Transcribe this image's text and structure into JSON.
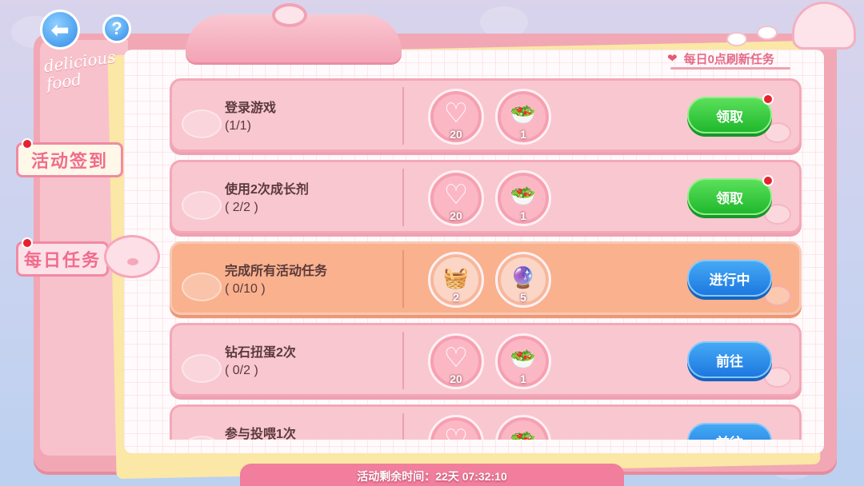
{
  "nav": {
    "back_icon": "back-arrow-icon",
    "help_label": "?"
  },
  "logo": {
    "line1": "delicious",
    "line2": "food"
  },
  "sidebar": {
    "tabs": [
      {
        "label": "活动签到",
        "badge": true
      },
      {
        "label": "每日任务",
        "badge": true,
        "selected": true
      }
    ]
  },
  "header": {
    "refresh_note": "每日0点刷新任务"
  },
  "tasks": [
    {
      "name": "登录游戏",
      "progress": "(1/1)",
      "rewards": [
        {
          "icon": "heart-candy-icon",
          "count": "20"
        },
        {
          "icon": "salad-bowl-icon",
          "count": "1"
        }
      ],
      "button": "领取",
      "button_style": "green",
      "badge": true
    },
    {
      "name": "使用2次成长剂",
      "progress": "( 2/2 )",
      "rewards": [
        {
          "icon": "heart-candy-icon",
          "count": "20"
        },
        {
          "icon": "salad-bowl-icon",
          "count": "1"
        }
      ],
      "button": "领取",
      "button_style": "green",
      "badge": true
    },
    {
      "name": "完成所有活动任务",
      "progress": "( 0/10 )",
      "rewards": [
        {
          "icon": "food-basket-icon",
          "count": "2"
        },
        {
          "icon": "snow-globe-icon",
          "count": "5"
        }
      ],
      "button": "进行中",
      "button_style": "blue",
      "badge": false,
      "active": true
    },
    {
      "name": "钻石扭蛋2次",
      "progress": "( 0/2 )",
      "rewards": [
        {
          "icon": "heart-candy-icon",
          "count": "20"
        },
        {
          "icon": "salad-bowl-icon",
          "count": "1"
        }
      ],
      "button": "前往",
      "button_style": "blue",
      "badge": false
    },
    {
      "name": "参与投喂1次",
      "progress": "",
      "rewards": [
        {
          "icon": "heart-candy-icon",
          "count": ""
        },
        {
          "icon": "salad-bowl-icon",
          "count": ""
        }
      ],
      "button": "前往",
      "button_style": "blue",
      "badge": false
    }
  ],
  "footer": {
    "timer": "活动剩余时间：22天 07:32:10"
  },
  "colors": {
    "accent_pink": "#f06c8d",
    "green_button": "#1fb82c",
    "blue_button": "#1d78e0",
    "badge_red": "#e5232f"
  }
}
